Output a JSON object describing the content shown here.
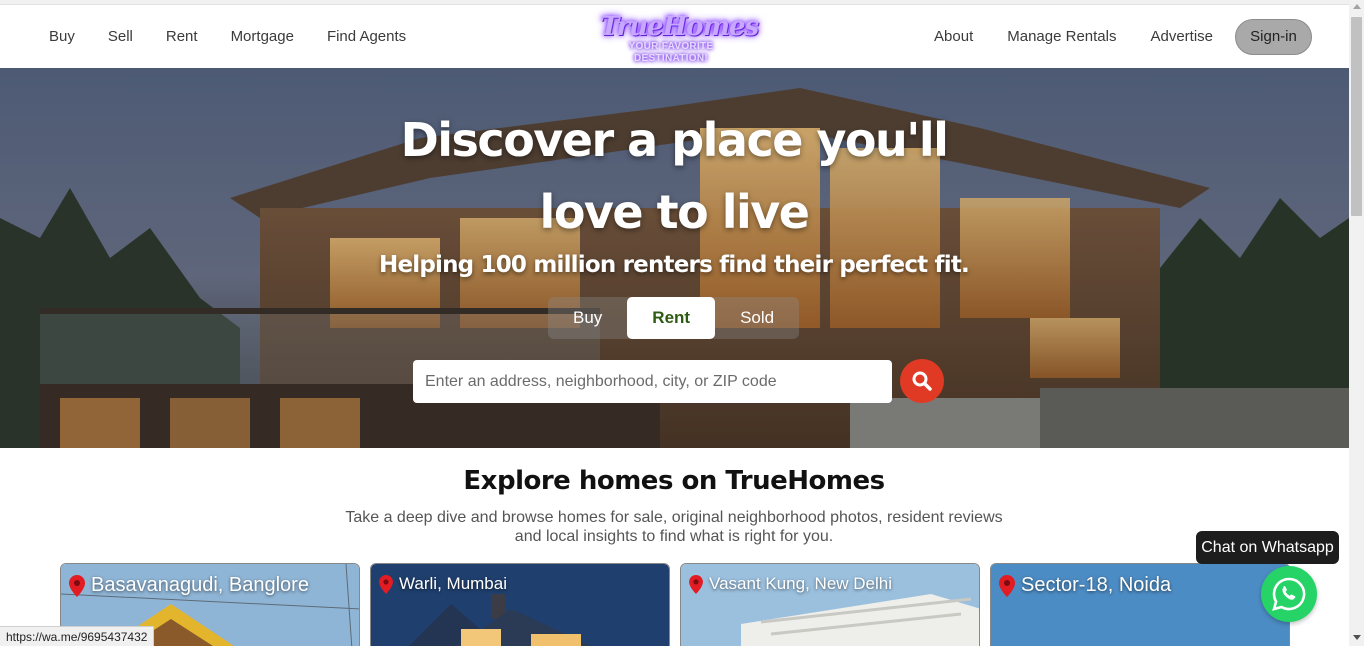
{
  "nav": {
    "left": [
      "Buy",
      "Sell",
      "Rent",
      "Mortgage",
      "Find Agents"
    ],
    "right": [
      "About",
      "Manage Rentals",
      "Advertise"
    ],
    "signin": "Sign-in"
  },
  "logo": {
    "name": "TrueHomes",
    "tagline": "YOUR FAVORITE DESTINATION!"
  },
  "hero": {
    "title_line1": "Discover a place you'll",
    "title_line2": "love to live",
    "subtitle": "Helping 100 million renters find their perfect fit.",
    "tabs": [
      {
        "label": "Buy",
        "active": false
      },
      {
        "label": "Rent",
        "active": true
      },
      {
        "label": "Sold",
        "active": false
      }
    ],
    "search_placeholder": "Enter an address, neighborhood, city, or ZIP code",
    "search_icon": "search-icon"
  },
  "explore": {
    "title": "Explore homes on TrueHomes",
    "description_line1": "Take a deep dive and browse homes for sale, original neighborhood photos, resident reviews",
    "description_line2": "and local insights to find what is right for you."
  },
  "cities": [
    {
      "name": "Basavanagudi, Banglore"
    },
    {
      "name": "Warli, Mumbai"
    },
    {
      "name": "Vasant Kung, New Delhi"
    },
    {
      "name": "Sector-18, Noida"
    }
  ],
  "whatsapp": {
    "label": "Chat on Whatsapp",
    "icon": "whatsapp-icon"
  },
  "status_url": "https://wa.me/9695437432",
  "colors": {
    "accent_red": "#e03a24",
    "active_tab_text": "#2e5b12",
    "whatsapp_green": "#25d366"
  }
}
